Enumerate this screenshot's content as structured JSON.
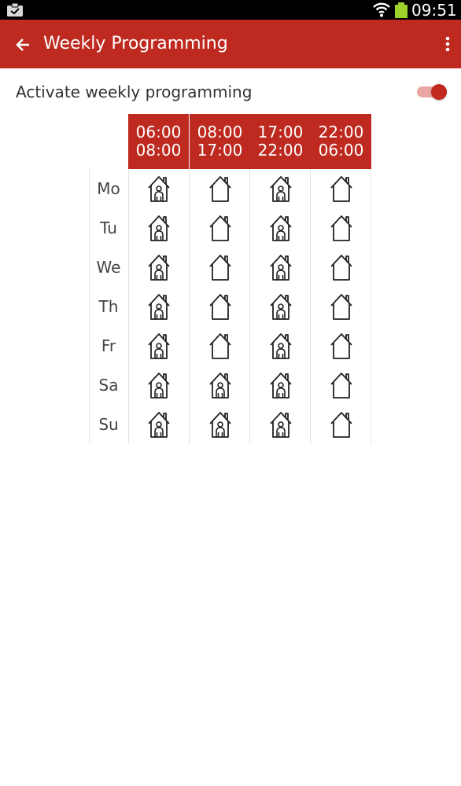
{
  "status_bar": {
    "time": "09:51",
    "icons": [
      "notification-clipboard-icon",
      "wifi-icon",
      "battery-icon"
    ]
  },
  "app_bar": {
    "title": "Weekly Programming",
    "back_icon": "arrow-left-icon",
    "menu_icon": "overflow-menu-icon",
    "background": "#be2a20"
  },
  "settings": {
    "toggle_label": "Activate weekly programming",
    "toggle_on": true,
    "accent": "#c1291e"
  },
  "schedule": {
    "slots": [
      {
        "start": "06:00",
        "end": "08:00"
      },
      {
        "start": "08:00",
        "end": "17:00"
      },
      {
        "start": "17:00",
        "end": "22:00"
      },
      {
        "start": "22:00",
        "end": "06:00"
      }
    ],
    "days": [
      {
        "label": "Mo",
        "modes": [
          "home-occupied-icon",
          "home-empty-icon",
          "home-occupied-icon",
          "home-empty-icon"
        ]
      },
      {
        "label": "Tu",
        "modes": [
          "home-occupied-icon",
          "home-empty-icon",
          "home-occupied-icon",
          "home-empty-icon"
        ]
      },
      {
        "label": "We",
        "modes": [
          "home-occupied-icon",
          "home-empty-icon",
          "home-occupied-icon",
          "home-empty-icon"
        ]
      },
      {
        "label": "Th",
        "modes": [
          "home-occupied-icon",
          "home-empty-icon",
          "home-occupied-icon",
          "home-empty-icon"
        ]
      },
      {
        "label": "Fr",
        "modes": [
          "home-occupied-icon",
          "home-empty-icon",
          "home-occupied-icon",
          "home-empty-icon"
        ]
      },
      {
        "label": "Sa",
        "modes": [
          "home-occupied-icon",
          "home-occupied-icon",
          "home-occupied-icon",
          "home-empty-icon"
        ]
      },
      {
        "label": "Su",
        "modes": [
          "home-occupied-icon",
          "home-occupied-icon",
          "home-occupied-icon",
          "home-empty-icon"
        ]
      }
    ]
  }
}
